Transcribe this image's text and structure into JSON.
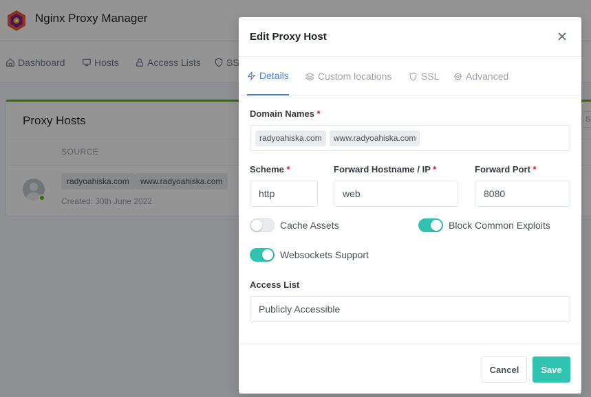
{
  "app": {
    "title": "Nginx Proxy Manager"
  },
  "nav": {
    "items": [
      {
        "label": "Dashboard",
        "icon": "home-icon"
      },
      {
        "label": "Hosts",
        "icon": "monitor-icon"
      },
      {
        "label": "Access Lists",
        "icon": "lock-icon"
      },
      {
        "label": "SSL",
        "icon": "shield-icon"
      }
    ]
  },
  "card": {
    "title": "Proxy Hosts",
    "column_source": "SOURCE",
    "row": {
      "domains": [
        "radyoahiska.com",
        "www.radyoahiska.com"
      ],
      "created": "Created: 30th June 2022"
    },
    "search_stub": "Se"
  },
  "modal": {
    "title": "Edit Proxy Host",
    "tabs": [
      {
        "label": "Details",
        "icon": "zap-icon",
        "active": true
      },
      {
        "label": "Custom locations",
        "icon": "layers-icon",
        "active": false
      },
      {
        "label": "SSL",
        "icon": "shield-icon",
        "active": false
      },
      {
        "label": "Advanced",
        "icon": "gear-icon",
        "active": false
      }
    ],
    "domain_names": {
      "label": "Domain Names",
      "required": "*",
      "values": [
        "radyoahiska.com",
        "www.radyoahiska.com"
      ]
    },
    "scheme": {
      "label": "Scheme",
      "required": "*",
      "value": "http"
    },
    "forward_host": {
      "label": "Forward Hostname / IP",
      "required": "*",
      "value": "web"
    },
    "forward_port": {
      "label": "Forward Port",
      "required": "*",
      "value": "8080"
    },
    "toggles": {
      "cache_assets": {
        "label": "Cache Assets",
        "on": false
      },
      "block_exploits": {
        "label": "Block Common Exploits",
        "on": true
      },
      "websockets": {
        "label": "Websockets Support",
        "on": true
      }
    },
    "access_list": {
      "label": "Access List",
      "value": "Publicly Accessible"
    },
    "buttons": {
      "cancel": "Cancel",
      "save": "Save"
    }
  },
  "colors": {
    "accent": "#467fcf",
    "toggle_on": "#2fc4b2",
    "save": "#2fc4b2",
    "card_top": "#5eba00",
    "required": "#cd201f"
  }
}
